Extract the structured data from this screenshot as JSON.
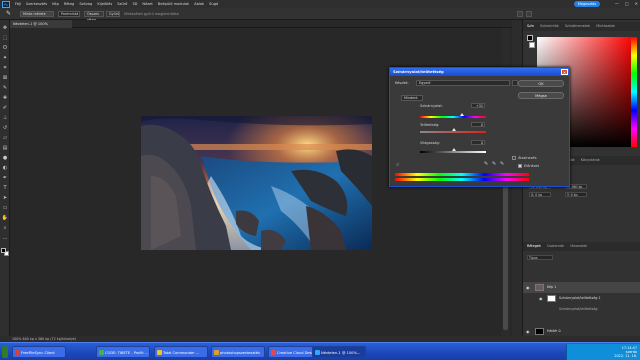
{
  "app": {
    "menu": [
      "Fájl",
      "Szerkesztés",
      "Kép",
      "Réteg",
      "Szöveg",
      "Kijelölés",
      "Szűrő",
      "3D",
      "Nézet",
      "Beépülő modulok",
      "Ablak",
      "Súgó"
    ],
    "share_label": "Megosztás",
    "window_controls": [
      "—",
      "□",
      "✕"
    ]
  },
  "options": {
    "field1": "Minta mérete",
    "field2": "Pontmintá",
    "field3": "Összes réteg",
    "field4": "Gyűrű",
    "field5": "Mintavételi gyűrű megjelenítése"
  },
  "document": {
    "tab": "Névtelen-1 @ 100% (Vazf/1,RGB/8) *"
  },
  "status": {
    "text": "100%    640 kp x 360 kp (72 kp/hüvelyk)"
  },
  "panels": {
    "color_tabs": [
      "Szín",
      "Színminták",
      "Színátmenetek",
      "Mintázatok"
    ],
    "props_tabs": [
      "Tulajdonságok",
      "Korrekciók",
      "Könyvtárak"
    ],
    "props_label": "Pixelréteg",
    "props_section": "Átalakítás",
    "props_w": "W: 640 kp",
    "props_h": "H: 360 kp",
    "props_x": "X: 0 kp",
    "props_y": "Y: 0 kp",
    "layer_tabs": [
      "Rétegek",
      "Csatornák",
      "Útvonalak"
    ],
    "layer_filter": "Típus",
    "layers": [
      {
        "name": "Kép 1"
      },
      {
        "name": "Színárnyalat/telítettség 1"
      },
      {
        "name": "Színárnyalat/telítettség"
      },
      {
        "name": "Háttér 0"
      }
    ]
  },
  "dialog": {
    "title": "Színárnyalat/telítettség",
    "preset_label": "Készlet:",
    "preset_value": "Egyedi",
    "channel_value": "Mindent",
    "hue_label": "Színárnyalat:",
    "hue_value": "+32",
    "sat_label": "Telítettség:",
    "sat_value": "0",
    "light_label": "Világosság:",
    "light_value": "0",
    "ok_label": "OK",
    "cancel_label": "Mégse",
    "colorize_label": "Átszínezés",
    "preview_label": "Előnézet"
  },
  "taskbar": {
    "items": [
      {
        "label": "FreeFileSync Client",
        "color": "#d84040"
      },
      {
        "label": "CODE: TIBETE - Profil: ...",
        "color": "#3fb34f"
      },
      {
        "label": "Total Commander ...",
        "color": "#f0c030"
      },
      {
        "label": "photoshopszerkesztés",
        "color": "#e0a020"
      },
      {
        "label": "Creative Cloud Deskt...",
        "color": "#e34850"
      },
      {
        "label": "Névtelen-1 @ 100%...",
        "color": "#31a8ff"
      }
    ],
    "time": "17:14:47",
    "day": "szerda",
    "date": "2022. 11. 16."
  },
  "colors": {
    "accent": "#2680eb",
    "taskbar": "#2a5fd6",
    "ps_blue": "#31a8ff"
  }
}
